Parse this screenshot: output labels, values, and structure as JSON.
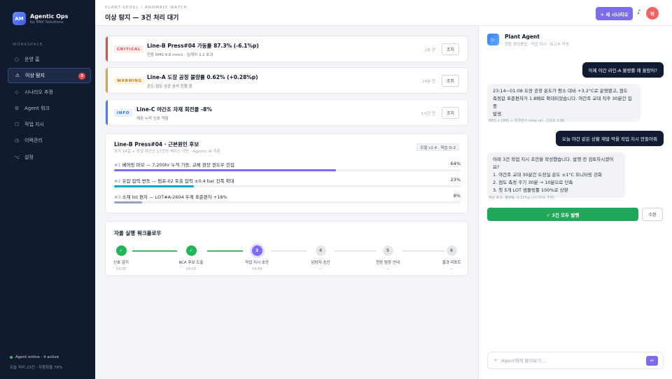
{
  "brand": {
    "logo": "AM",
    "name": "Agentic Ops",
    "sub": "by RNV Solutions"
  },
  "sidebar": {
    "section_label": "WORKSPACE",
    "items": [
      {
        "icon": "○",
        "label": "운영 홈"
      },
      {
        "icon": "⚠",
        "label": "이상 탐지",
        "badge": "3"
      },
      {
        "icon": "◇",
        "label": "시나리오 추정"
      },
      {
        "icon": "⚙",
        "label": "Agent 워크"
      },
      {
        "icon": "☐",
        "label": "작업 지시"
      },
      {
        "icon": "◷",
        "label": "이력관리"
      },
      {
        "icon": "⌥",
        "label": "설정"
      }
    ],
    "agent_status": "Agent online · 4 active",
    "today_stats": "오늘 처리 23건 · 자동화율 78%"
  },
  "header": {
    "breadcrumb": "PLANT-SEOUL / ANOMALY WATCH",
    "title": "이상 탐지 — 3건 처리 대기",
    "new_button": "+ 새 시나리오",
    "avatar": "박"
  },
  "alerts": [
    {
      "tag": "CRITICAL",
      "title": "Line-B Press#04 가동률 87.3% (-6.1%p)",
      "desc": "진동 RMS 4.8 mm/s · 임계치 3.2 초과",
      "time": "2분 전",
      "action": "조치",
      "color": "#e5484d",
      "tag_bg": "#fdecec"
    },
    {
      "tag": "WARNING",
      "title": "Line-A 도장 공정 불량률 0.62% (+0.28%p)",
      "desc": "온도-점도 상관 분석 진행 중",
      "time": "14분 전",
      "action": "조치",
      "color": "#e9a23b",
      "tag_bg": "#fdf3e2"
    },
    {
      "tag": "INFO",
      "title": "Line-C 야간조 자재 회전율 -8%",
      "desc": "재공 누적 신호 약함",
      "time": "1시간 전",
      "action": "조치",
      "color": "#3b82f6",
      "tag_bg": "#e8f0fe"
    }
  ],
  "root_cause": {
    "title": "Line-B Press#04 · 근본원인 후보",
    "subtitle": "과거 14일 + 동일 자산군 17건의 케이스 기반 · Agentic AI 추론",
    "model": "모델 v2.4 · 학습 D-2",
    "causes": [
      {
        "num": "#1",
        "label": "베어링 마모 — 7,200hr 누적 가동, 교체 권장 윈도우 진입",
        "pct": "64%",
        "value": 0.64,
        "color": "#7c6cf0"
      },
      {
        "num": "#2",
        "label": "유압 압력 변동 — 펌프-02 토출 압력 ±0.4 bar 진폭 확대",
        "pct": "23%",
        "value": 0.23,
        "color": "#14a3c4"
      },
      {
        "num": "#3",
        "label": "소재 lot 편차 — LOT#A-2604 두께 표준편차 +18%",
        "pct": "8%",
        "value": 0.08,
        "color": "#94a3b8"
      }
    ]
  },
  "workflow": {
    "title": "자율 실행 워크플로우",
    "steps": [
      {
        "mark": "✓",
        "label": "신호 감지",
        "time": "14:02",
        "state": "done"
      },
      {
        "mark": "✓",
        "label": "RCA 후보 도출",
        "time": "14:03",
        "state": "done"
      },
      {
        "mark": "3",
        "label": "작업 지시 초안",
        "time": "14:04",
        "state": "active"
      },
      {
        "mark": "4",
        "label": "담당자 승인",
        "time": "—",
        "state": "pending"
      },
      {
        "mark": "5",
        "label": "현장 팀장 안내",
        "time": "—",
        "state": "pending"
      },
      {
        "mark": "6",
        "label": "결과 리포트",
        "time": "—",
        "state": "pending"
      }
    ]
  },
  "agent_panel": {
    "icon": "▷",
    "name": "Plant Agent",
    "sub": "현장 정의용입 · 작업 지시 · 보고서 작성",
    "messages": [
      {
        "role": "user",
        "text": "어제 야간 라인-A 불량률 왜 올랐어?"
      },
      {
        "role": "bot",
        "lines": [
          "23:14~01:08 도장 공정 온도가 평소 대비 +3.2°C로 운영됐고, 점도",
          "측정값 표준편차가 1.8배로 확대되었습니다. 야간조 교대 직후 30분간 집중",
          "발생."
        ],
        "meta": "MES + QMS + 환경센서 mixe ref · 신뢰도 0.86"
      },
      {
        "role": "user",
        "text": "오늘 야간 같은 상황 재발 막을 작업 지시 만들어줘"
      },
      {
        "role": "bot",
        "lines": [
          "아래 3건 작업 지시 초안을 작성했습니다. 발행 전 검토하시겠어요?",
          "1. 야간조 교대 30분간 도장실 온도 ±1°C 모니터링 강화",
          "2. 점도 측정 주기 30분 → 10분으로 단축",
          "3. 첫 5개 LOT 샘플링률 100%로 상향"
        ],
        "meta": "예상 효과: 불량률 -0.21%p (시나리오 추정)"
      }
    ],
    "send_all": "✓ 3건 모두 발행",
    "edit": "수정",
    "input_placeholder": "Agent에게 물어보기...",
    "send_icon": "↵"
  }
}
